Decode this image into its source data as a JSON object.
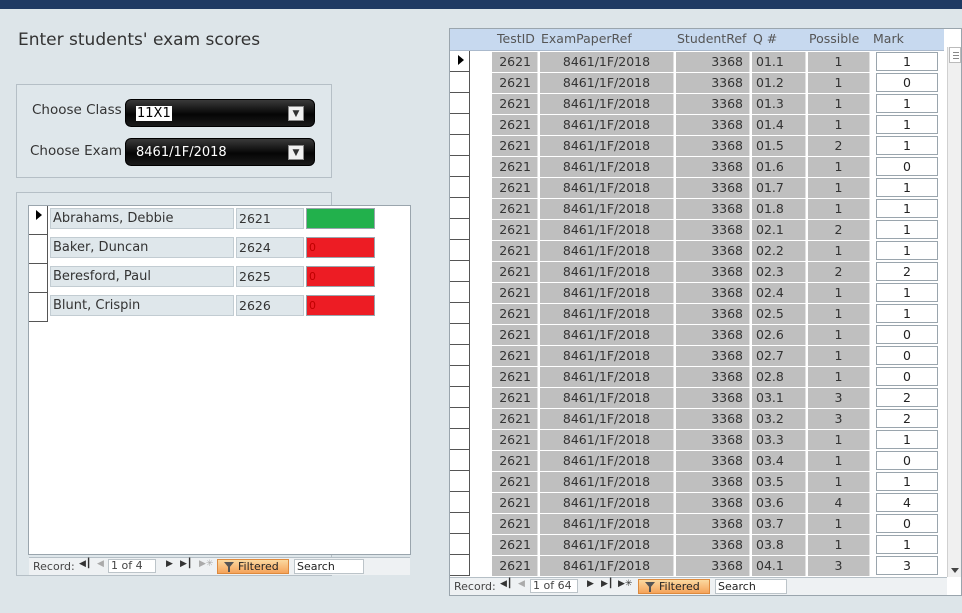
{
  "page": {
    "title": "Enter students' exam scores"
  },
  "filters": {
    "class_label": "Choose Class",
    "class_value": "11X1",
    "exam_label": "Choose Exam",
    "exam_value": "8461/1F/2018"
  },
  "students": {
    "rows": [
      {
        "name": "Abrahams, Debbie",
        "id": "2621",
        "status_text": "",
        "status_color": "#22b14c"
      },
      {
        "name": "Baker, Duncan",
        "id": "2624",
        "status_text": "0",
        "status_color": "#ed1c24"
      },
      {
        "name": "Beresford, Paul",
        "id": "2625",
        "status_text": "0",
        "status_color": "#ed1c24"
      },
      {
        "name": "Blunt, Crispin",
        "id": "2626",
        "status_text": "0",
        "status_color": "#ed1c24"
      }
    ],
    "nav": {
      "record_label": "Record:",
      "position": "1 of 4",
      "filtered_label": "Filtered",
      "search_label": "Search"
    }
  },
  "marks": {
    "headers": {
      "test_id": "TestID",
      "exam_paper_ref": "ExamPaperRef",
      "student_ref": "StudentRef",
      "question": "Q #",
      "possible": "Possible",
      "mark": "Mark"
    },
    "rows": [
      {
        "test_id": "2621",
        "exam": "8461/1F/2018",
        "student": "3368",
        "q": "01.1",
        "possible": "1",
        "mark": "1"
      },
      {
        "test_id": "2621",
        "exam": "8461/1F/2018",
        "student": "3368",
        "q": "01.2",
        "possible": "1",
        "mark": "0"
      },
      {
        "test_id": "2621",
        "exam": "8461/1F/2018",
        "student": "3368",
        "q": "01.3",
        "possible": "1",
        "mark": "1"
      },
      {
        "test_id": "2621",
        "exam": "8461/1F/2018",
        "student": "3368",
        "q": "01.4",
        "possible": "1",
        "mark": "1"
      },
      {
        "test_id": "2621",
        "exam": "8461/1F/2018",
        "student": "3368",
        "q": "01.5",
        "possible": "2",
        "mark": "1"
      },
      {
        "test_id": "2621",
        "exam": "8461/1F/2018",
        "student": "3368",
        "q": "01.6",
        "possible": "1",
        "mark": "0"
      },
      {
        "test_id": "2621",
        "exam": "8461/1F/2018",
        "student": "3368",
        "q": "01.7",
        "possible": "1",
        "mark": "1"
      },
      {
        "test_id": "2621",
        "exam": "8461/1F/2018",
        "student": "3368",
        "q": "01.8",
        "possible": "1",
        "mark": "1"
      },
      {
        "test_id": "2621",
        "exam": "8461/1F/2018",
        "student": "3368",
        "q": "02.1",
        "possible": "2",
        "mark": "1"
      },
      {
        "test_id": "2621",
        "exam": "8461/1F/2018",
        "student": "3368",
        "q": "02.2",
        "possible": "1",
        "mark": "1"
      },
      {
        "test_id": "2621",
        "exam": "8461/1F/2018",
        "student": "3368",
        "q": "02.3",
        "possible": "2",
        "mark": "2"
      },
      {
        "test_id": "2621",
        "exam": "8461/1F/2018",
        "student": "3368",
        "q": "02.4",
        "possible": "1",
        "mark": "1"
      },
      {
        "test_id": "2621",
        "exam": "8461/1F/2018",
        "student": "3368",
        "q": "02.5",
        "possible": "1",
        "mark": "1"
      },
      {
        "test_id": "2621",
        "exam": "8461/1F/2018",
        "student": "3368",
        "q": "02.6",
        "possible": "1",
        "mark": "0"
      },
      {
        "test_id": "2621",
        "exam": "8461/1F/2018",
        "student": "3368",
        "q": "02.7",
        "possible": "1",
        "mark": "0"
      },
      {
        "test_id": "2621",
        "exam": "8461/1F/2018",
        "student": "3368",
        "q": "02.8",
        "possible": "1",
        "mark": "0"
      },
      {
        "test_id": "2621",
        "exam": "8461/1F/2018",
        "student": "3368",
        "q": "03.1",
        "possible": "3",
        "mark": "2"
      },
      {
        "test_id": "2621",
        "exam": "8461/1F/2018",
        "student": "3368",
        "q": "03.2",
        "possible": "3",
        "mark": "2"
      },
      {
        "test_id": "2621",
        "exam": "8461/1F/2018",
        "student": "3368",
        "q": "03.3",
        "possible": "1",
        "mark": "1"
      },
      {
        "test_id": "2621",
        "exam": "8461/1F/2018",
        "student": "3368",
        "q": "03.4",
        "possible": "1",
        "mark": "0"
      },
      {
        "test_id": "2621",
        "exam": "8461/1F/2018",
        "student": "3368",
        "q": "03.5",
        "possible": "1",
        "mark": "1"
      },
      {
        "test_id": "2621",
        "exam": "8461/1F/2018",
        "student": "3368",
        "q": "03.6",
        "possible": "4",
        "mark": "4"
      },
      {
        "test_id": "2621",
        "exam": "8461/1F/2018",
        "student": "3368",
        "q": "03.7",
        "possible": "1",
        "mark": "0"
      },
      {
        "test_id": "2621",
        "exam": "8461/1F/2018",
        "student": "3368",
        "q": "03.8",
        "possible": "1",
        "mark": "1"
      },
      {
        "test_id": "2621",
        "exam": "8461/1F/2018",
        "student": "3368",
        "q": "04.1",
        "possible": "3",
        "mark": "3"
      }
    ],
    "nav": {
      "record_label": "Record:",
      "position": "1 of 64",
      "filtered_label": "Filtered",
      "search_label": "Search"
    }
  }
}
